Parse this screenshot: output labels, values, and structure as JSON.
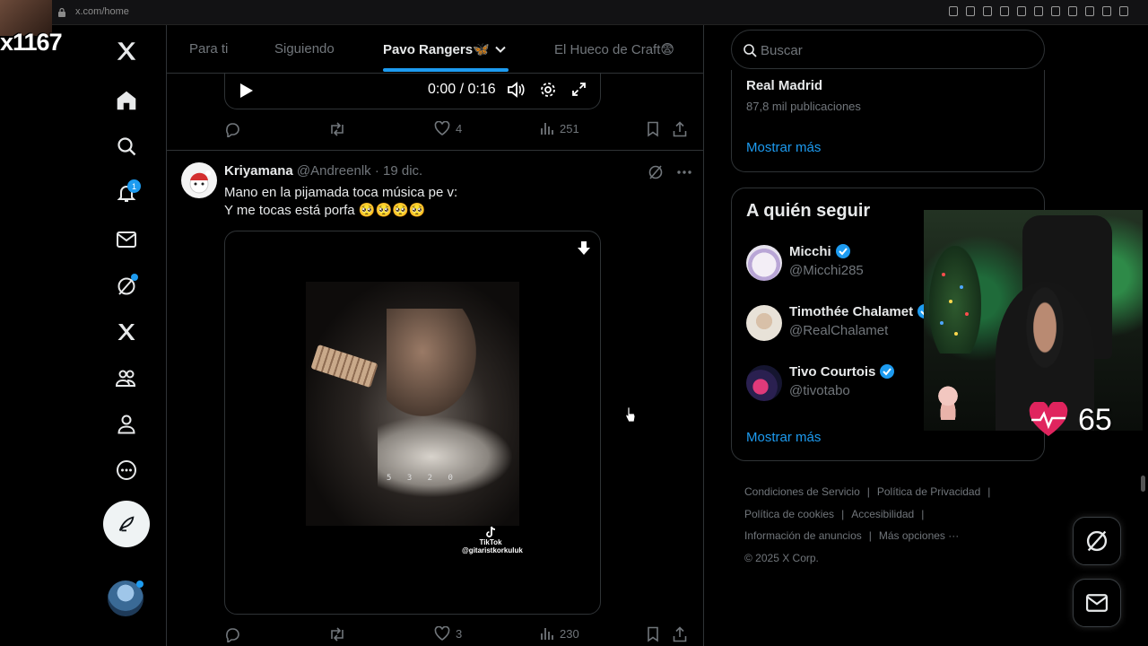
{
  "browser": {
    "url": "x.com/home"
  },
  "overlay": {
    "handle": "x1167"
  },
  "nav": {
    "notifications_badge": "1",
    "items": [
      {
        "name": "x-logo-icon"
      },
      {
        "name": "home-icon"
      },
      {
        "name": "search-icon"
      },
      {
        "name": "notifications-icon"
      },
      {
        "name": "messages-icon"
      },
      {
        "name": "grok-icon"
      },
      {
        "name": "x-premium-icon"
      },
      {
        "name": "communities-icon"
      },
      {
        "name": "profile-icon"
      },
      {
        "name": "more-icon"
      }
    ]
  },
  "tabs": [
    {
      "label": "Para ti"
    },
    {
      "label": "Siguiendo"
    },
    {
      "label": "Pavo Rangers🦋"
    },
    {
      "label": "El Hueco de Craft😨"
    }
  ],
  "prev_tweet": {
    "video_time": "0:00 / 0:16",
    "likes": "4",
    "views": "251"
  },
  "tweet": {
    "name": "Kriyamana",
    "handle": "@Andreenlk",
    "date": "· 19 dic.",
    "text_line1": "Mano en la pijamada toca música pe v:",
    "text_line2": "Y me tocas está porfa 🥺🥺🥺🥺",
    "media_tab": "5  3  2  0",
    "tiktok_label": "TikTok",
    "tiktok_user": "@gitaristkorkuluk",
    "likes": "3",
    "views": "230"
  },
  "search": {
    "placeholder": "Buscar"
  },
  "trend": {
    "title": "Real Madrid",
    "count": "87,8 mil publicaciones",
    "show_more": "Mostrar más"
  },
  "who_to_follow": {
    "title": "A quién seguir",
    "users": [
      {
        "name": "Micchi",
        "handle": "@Micchi285",
        "verified": true
      },
      {
        "name": "Timothée Chalamet",
        "handle": "@RealChalamet",
        "verified": true
      },
      {
        "name": "Tivo Courtois",
        "handle": "@tivotabo",
        "verified": true
      }
    ],
    "show_more": "Mostrar más"
  },
  "footer": {
    "terms": "Condiciones de Servicio",
    "privacy": "Política de Privacidad",
    "cookies": "Política de cookies",
    "accessibility": "Accesibilidad",
    "ads_info": "Información de anuncios",
    "more": "Más opciones ···",
    "copyright": "© 2025 X Corp."
  },
  "stream": {
    "heart_rate": "65"
  },
  "colors": {
    "accent": "#1d9bf0",
    "text": "#e7e9ea",
    "muted": "#71767b",
    "border": "#2f3336",
    "heart": "#e0245e"
  }
}
